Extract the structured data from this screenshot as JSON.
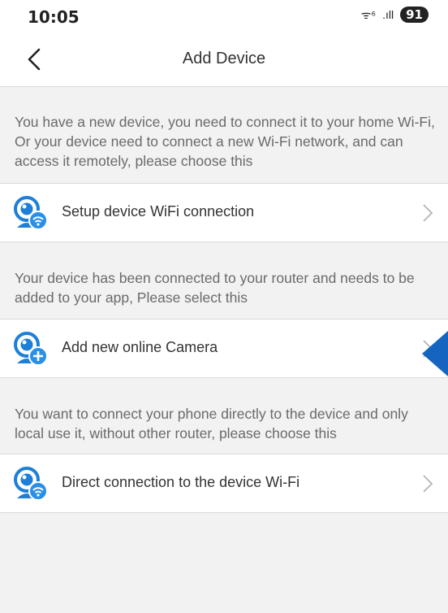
{
  "status": {
    "time": "10:05",
    "network": "ᯤ⁶",
    "signal": ".ıll",
    "battery": "91"
  },
  "nav": {
    "title": "Add Device"
  },
  "sections": [
    {
      "description": "You have a new device, you need to connect it to your home Wi-Fi, Or your device need to connect a new Wi-Fi network, and can access it remotely, please choose this",
      "option_label": "Setup device WiFi connection",
      "icon": "camera-wifi-icon"
    },
    {
      "description": "Your device has been connected to your router and needs to be added to your app, Please select this",
      "option_label": "Add new online Camera",
      "icon": "camera-add-icon"
    },
    {
      "description": "You want to connect your phone directly to the device and only local use it, without other router, please choose this",
      "option_label": "Direct connection to the device Wi-Fi",
      "icon": "camera-wifi-icon"
    }
  ],
  "colors": {
    "icon_blue": "#1e7fd8",
    "icon_badge_blue": "#2a8fe6",
    "pointer_blue": "#1565c0",
    "background": "#f2f2f2"
  }
}
